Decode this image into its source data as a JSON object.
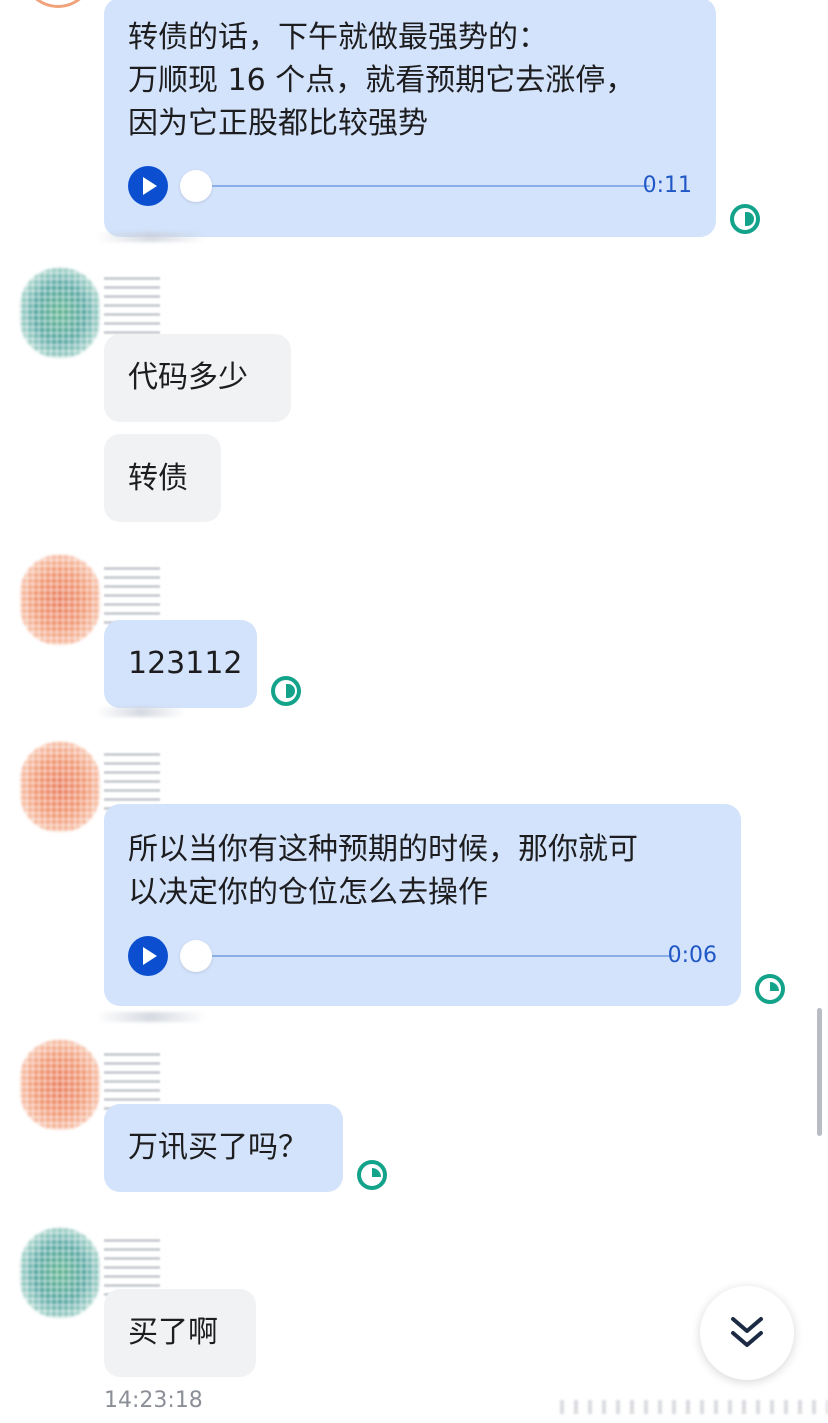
{
  "messages": [
    {
      "type": "voice",
      "text_line1": "转债的话，下午就做最强势的：",
      "text_line2": "万顺现 16 个点，就看预期它去涨停，",
      "text_line3": "因为它正股都比较强势",
      "duration": "0:11"
    },
    {
      "type": "text",
      "text": "代码多少"
    },
    {
      "type": "text",
      "text": "转债"
    },
    {
      "type": "text",
      "text": "123112"
    },
    {
      "type": "voice",
      "text_line1": "所以当你有这种预期的时候，那你就可",
      "text_line2": "以决定你的仓位怎么去操作",
      "duration": "0:06"
    },
    {
      "type": "text",
      "text": "万讯买了吗？"
    },
    {
      "type": "text",
      "text": "买了啊"
    }
  ],
  "timestamp": "14:23:18",
  "icons": {
    "play": "play-icon",
    "read_status": "read-status-icon",
    "scroll_down": "double-chevron-down-icon"
  },
  "colors": {
    "own_bubble": "#d3e3fb",
    "other_bubble": "#f1f2f4",
    "play_button": "#0b4fd0",
    "status": "#13a38b"
  }
}
